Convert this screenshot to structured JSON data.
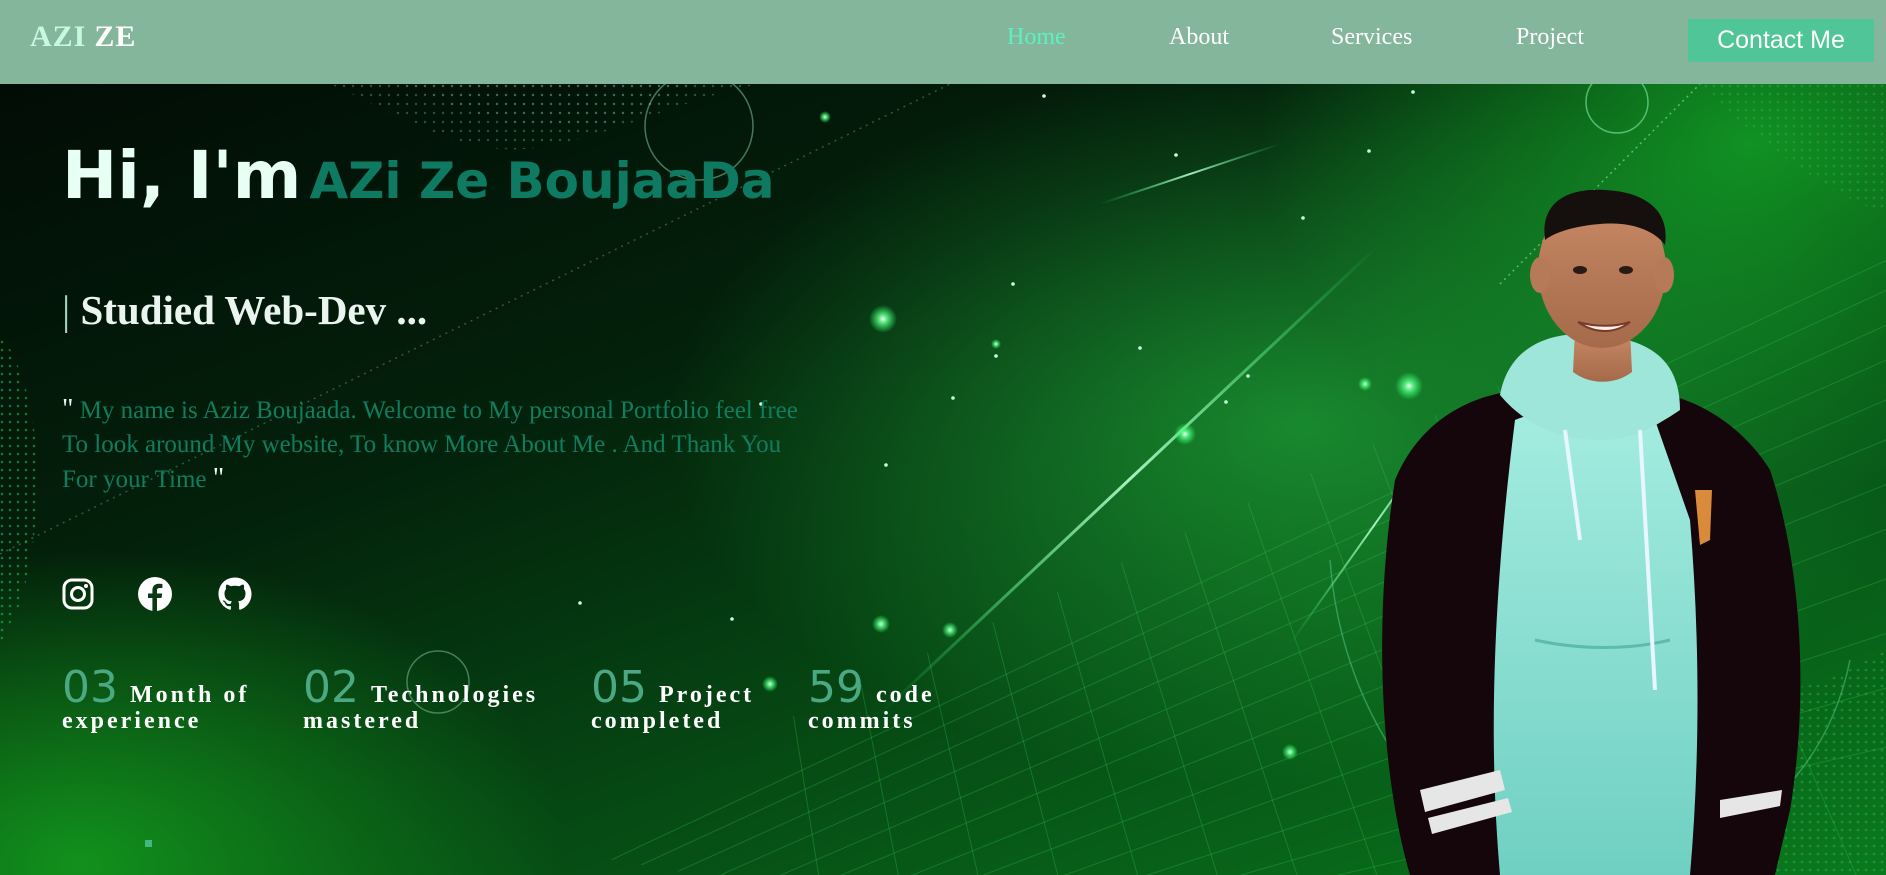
{
  "brand": {
    "logo_part1": "AZI",
    "logo_part2": "ZE"
  },
  "nav": {
    "items": [
      {
        "label": "Home",
        "active": true
      },
      {
        "label": "About",
        "active": false
      },
      {
        "label": "Services",
        "active": false
      },
      {
        "label": "Project",
        "active": false
      }
    ],
    "contact_label": "Contact Me"
  },
  "hero": {
    "greeting": "Hi, I'm",
    "name": "AZi Ze BoujaaDa",
    "role_bar": "|",
    "role": "Studied Web-Dev ...",
    "quote_open": "\"",
    "quote_text": "My name is Aziz Boujaada. Welcome to My personal Portfolio feel free To look around My website, To know More About Me . And Thank You For your Time",
    "quote_close": "\""
  },
  "social": [
    {
      "icon": "instagram-icon"
    },
    {
      "icon": "facebook-icon"
    },
    {
      "icon": "github-icon"
    }
  ],
  "stats": [
    {
      "number": "03",
      "line1": "Month of",
      "line2": "experience"
    },
    {
      "number": "02",
      "line1": "Technologies",
      "line2": "mastered"
    },
    {
      "number": "05",
      "line1": "Project",
      "line2": "completed"
    },
    {
      "number": "59",
      "line1": "code",
      "line2": "commits"
    }
  ],
  "colors": {
    "navbar": "#83b69a",
    "accent": "#4fc598",
    "active_link": "#5ff0c0",
    "name": "#0e7a62",
    "quote": "#0f7e60",
    "stat_number": "#4aa882"
  }
}
